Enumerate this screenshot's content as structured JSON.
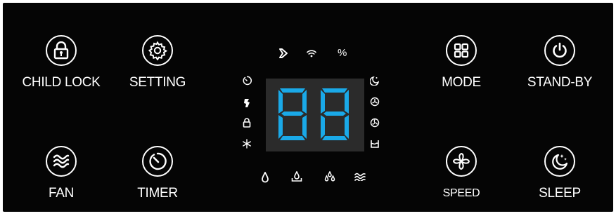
{
  "panel": {
    "background": "#050505",
    "accent_color": "#1aa9e8"
  },
  "buttons": {
    "child_lock": {
      "label": "CHILD LOCK",
      "icon": "padlock-icon"
    },
    "setting": {
      "label": "SETTING",
      "icon": "gear-icon"
    },
    "fan": {
      "label": "FAN",
      "icon": "waves-icon"
    },
    "timer": {
      "label": "TIMER",
      "icon": "clock-icon"
    },
    "mode": {
      "label": "MODE",
      "icon": "grid-icon"
    },
    "standby": {
      "label": "STAND-BY",
      "icon": "power-icon"
    },
    "speed": {
      "label": "SPEED",
      "icon": "fan-blades-icon"
    },
    "sleep": {
      "label": "SLEEP",
      "icon": "moon-stars-icon"
    }
  },
  "display": {
    "digits": "88",
    "top_indicators": [
      {
        "icon": "pump-icon"
      },
      {
        "icon": "wifi-icon"
      },
      {
        "label": "%"
      }
    ],
    "left_indicators": [
      "timer-indicator-icon",
      "drainage-indicator-icon",
      "lock-indicator-icon",
      "defrost-indicator-icon"
    ],
    "right_indicators": [
      "sleep-indicator-icon",
      "low-fan-indicator-icon",
      "high-fan-indicator-icon",
      "tank-indicator-icon"
    ],
    "bottom_indicators": [
      "single-drop-icon",
      "drop-tray-icon",
      "triple-drop-icon",
      "dry-wave-icon"
    ]
  }
}
